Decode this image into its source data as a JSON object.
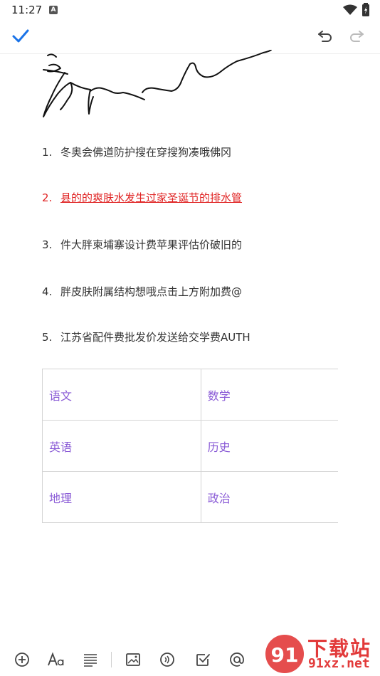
{
  "status_bar": {
    "time": "11:27",
    "notification_badge": "A"
  },
  "toolbar": {
    "confirm_icon": "check-icon",
    "undo_icon": "undo-icon",
    "redo_icon": "redo-icon",
    "accent_color": "#1a73e8"
  },
  "content": {
    "list": [
      {
        "num": "1.",
        "text": "冬奥会佛道防护搜在穿搜狗凑哦佛冈"
      },
      {
        "num": "2.",
        "text": "县的的爽肤水发生过家圣诞节的排水管",
        "color": "#e02424"
      },
      {
        "num": "3.",
        "text": "件大胖柬埔寨设计费苹果评估价破旧的"
      },
      {
        "num": "4.",
        "text": "胖皮肤附属结构想哦点击上方附加费@"
      },
      {
        "num": "5.",
        "text": "江苏省配件费批发价发送给交学费AUTH"
      }
    ],
    "table": [
      [
        "语文",
        "数学"
      ],
      [
        "英语",
        "历史"
      ],
      [
        "地理",
        "政治"
      ]
    ],
    "table_text_color": "#8a5bd6"
  },
  "bottom_bar": {
    "icons": [
      "add-icon",
      "text-format-icon",
      "align-icon",
      "image-icon",
      "audio-icon",
      "checkbox-icon",
      "mention-icon"
    ]
  },
  "watermark": {
    "brand": "下载站",
    "url": "91xz.net",
    "logo_text": "91"
  }
}
